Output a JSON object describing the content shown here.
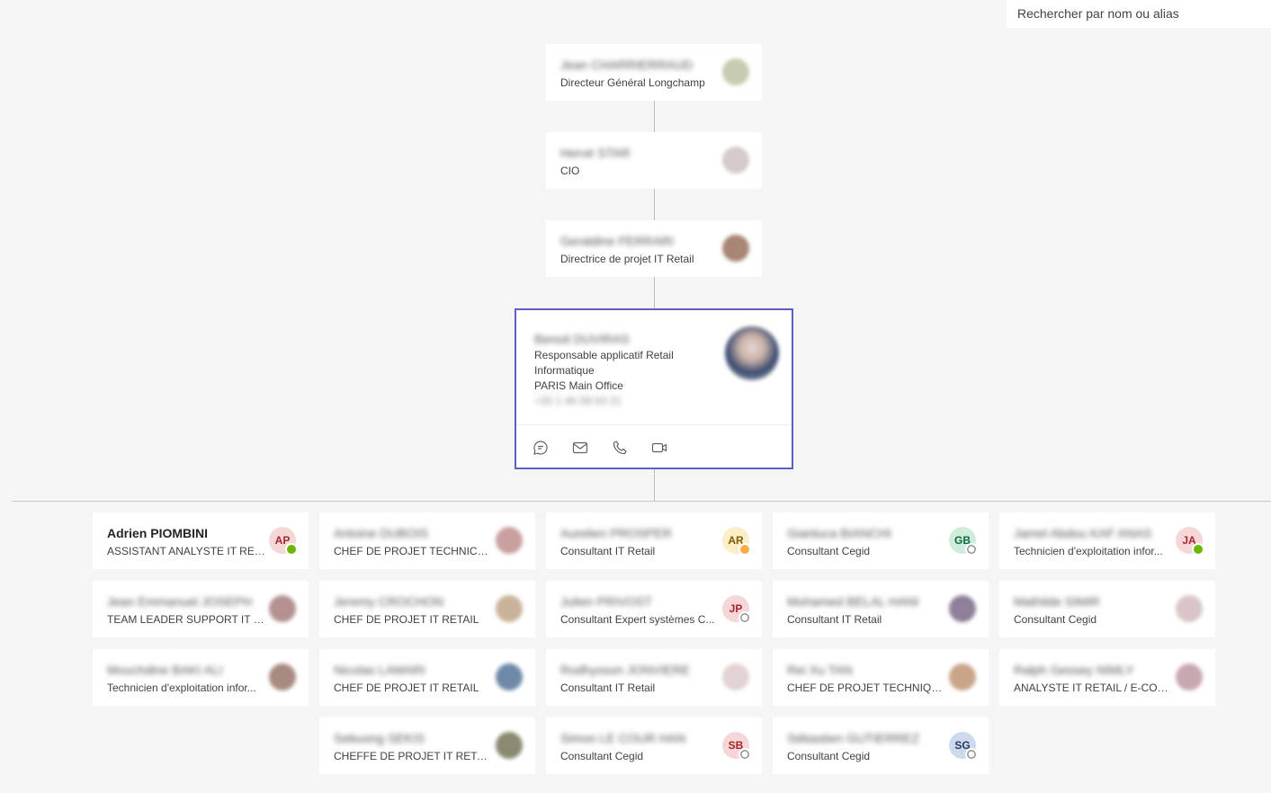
{
  "search": {
    "placeholder": "Rechercher par nom ou alias"
  },
  "managers": [
    {
      "name": "Jean CHARRIERRAUD",
      "title": "Directeur Général Longchamp"
    },
    {
      "name": "Hervé STAR",
      "title": "CIO"
    },
    {
      "name": "Geraldine FERRARI",
      "title": "Directrice de projet IT Retail"
    }
  ],
  "focus": {
    "name": "Benoit DUVIRAS",
    "title_line1": "Responsable applicatif Retail",
    "title_line2": "Informatique",
    "office": "PARIS Main Office",
    "phone": "+33 1 40 59 53 21",
    "actions": [
      "chat-icon",
      "mail-icon",
      "phone-icon",
      "video-icon"
    ]
  },
  "reports": [
    {
      "name": "Adrien PIOMBINI",
      "title": "ASSISTANT ANALYSTE IT RETAIL",
      "initials": "AP",
      "status": "available",
      "avatar_bg": "#f6d7d7",
      "avatar_fg": "#a4262c"
    },
    {
      "name": "Antoine DUBOIS",
      "title": "CHEF DE PROJET TECHNICO F...",
      "initials": "",
      "status": "",
      "avatar_bg": "#c9a0a0",
      "avatar_fg": "#ffffff"
    },
    {
      "name": "Aurelien PROSPER",
      "title": "Consultant IT Retail",
      "initials": "AR",
      "status": "away",
      "avatar_bg": "#fbeec8",
      "avatar_fg": "#835c00"
    },
    {
      "name": "Gianluca BIANCHI",
      "title": "Consultant Cegid",
      "initials": "GB",
      "status": "offline",
      "avatar_bg": "#cfecdc",
      "avatar_fg": "#0b6a3b"
    },
    {
      "name": "Jamel Abdou KAF ANAS",
      "title": "Technicien d'exploitation infor...",
      "initials": "JA",
      "status": "available",
      "avatar_bg": "#f6d7d7",
      "avatar_fg": "#a4262c"
    },
    {
      "name": "Jean Emmanuel JOSEPH",
      "title": "TEAM LEADER SUPPORT IT RE...",
      "initials": "",
      "status": "",
      "avatar_bg": "#b59090",
      "avatar_fg": "#ffffff"
    },
    {
      "name": "Jeremy CROCHON",
      "title": "CHEF DE PROJET IT RETAIL",
      "initials": "",
      "status": "",
      "avatar_bg": "#c9b29a",
      "avatar_fg": "#ffffff"
    },
    {
      "name": "Julien PRIVOST",
      "title": "Consultant Expert systèmes C...",
      "initials": "JP",
      "status": "offline",
      "avatar_bg": "#f6d7d7",
      "avatar_fg": "#a4262c"
    },
    {
      "name": "Mohamed BELAL HANI",
      "title": "Consultant IT Retail",
      "initials": "",
      "status": "",
      "avatar_bg": "#8e7f9a",
      "avatar_fg": "#ffffff"
    },
    {
      "name": "Mathilde SIMIR",
      "title": "Consultant Cegid",
      "initials": "",
      "status": "",
      "avatar_bg": "#d9c5c5",
      "avatar_fg": "#ffffff"
    },
    {
      "name": "Mouchdine BAKI ALI",
      "title": "Technicien d'exploitation infor...",
      "initials": "",
      "status": "",
      "avatar_bg": "#a88a80",
      "avatar_fg": "#ffffff"
    },
    {
      "name": "Nicolas LAMARI",
      "title": "CHEF DE PROJET IT RETAIL",
      "initials": "",
      "status": "",
      "avatar_bg": "#6f8aa8",
      "avatar_fg": "#ffffff"
    },
    {
      "name": "Rodhysson JONVIERE",
      "title": "Consultant IT Retail",
      "initials": "",
      "status": "",
      "avatar_bg": "#e2d2d2",
      "avatar_fg": "#ffffff"
    },
    {
      "name": "Rei Xu TAN",
      "title": "CHEF DE PROJET TECHNIQUE ...",
      "initials": "",
      "status": "",
      "avatar_bg": "#c9a489",
      "avatar_fg": "#ffffff"
    },
    {
      "name": "Ralph Gessey NIMLY",
      "title": "ANALYSTE IT RETAIL / E-COM...",
      "initials": "",
      "status": "",
      "avatar_bg": "#c9a7b0",
      "avatar_fg": "#ffffff"
    },
    {
      "name": "Sebuong SEKIS",
      "title": "CHEFFE DE PROJET IT RETAIL",
      "initials": "",
      "status": "",
      "avatar_bg": "#8a8a70",
      "avatar_fg": "#ffffff"
    },
    {
      "name": "Simon LE COUR HAN",
      "title": "Consultant Cegid",
      "initials": "SB",
      "status": "offline",
      "avatar_bg": "#f6d7d7",
      "avatar_fg": "#a4262c"
    },
    {
      "name": "Sébastien GUTIERREZ",
      "title": "Consultant Cegid",
      "initials": "SG",
      "status": "offline",
      "avatar_bg": "#cdd9ec",
      "avatar_fg": "#243a5e"
    }
  ]
}
